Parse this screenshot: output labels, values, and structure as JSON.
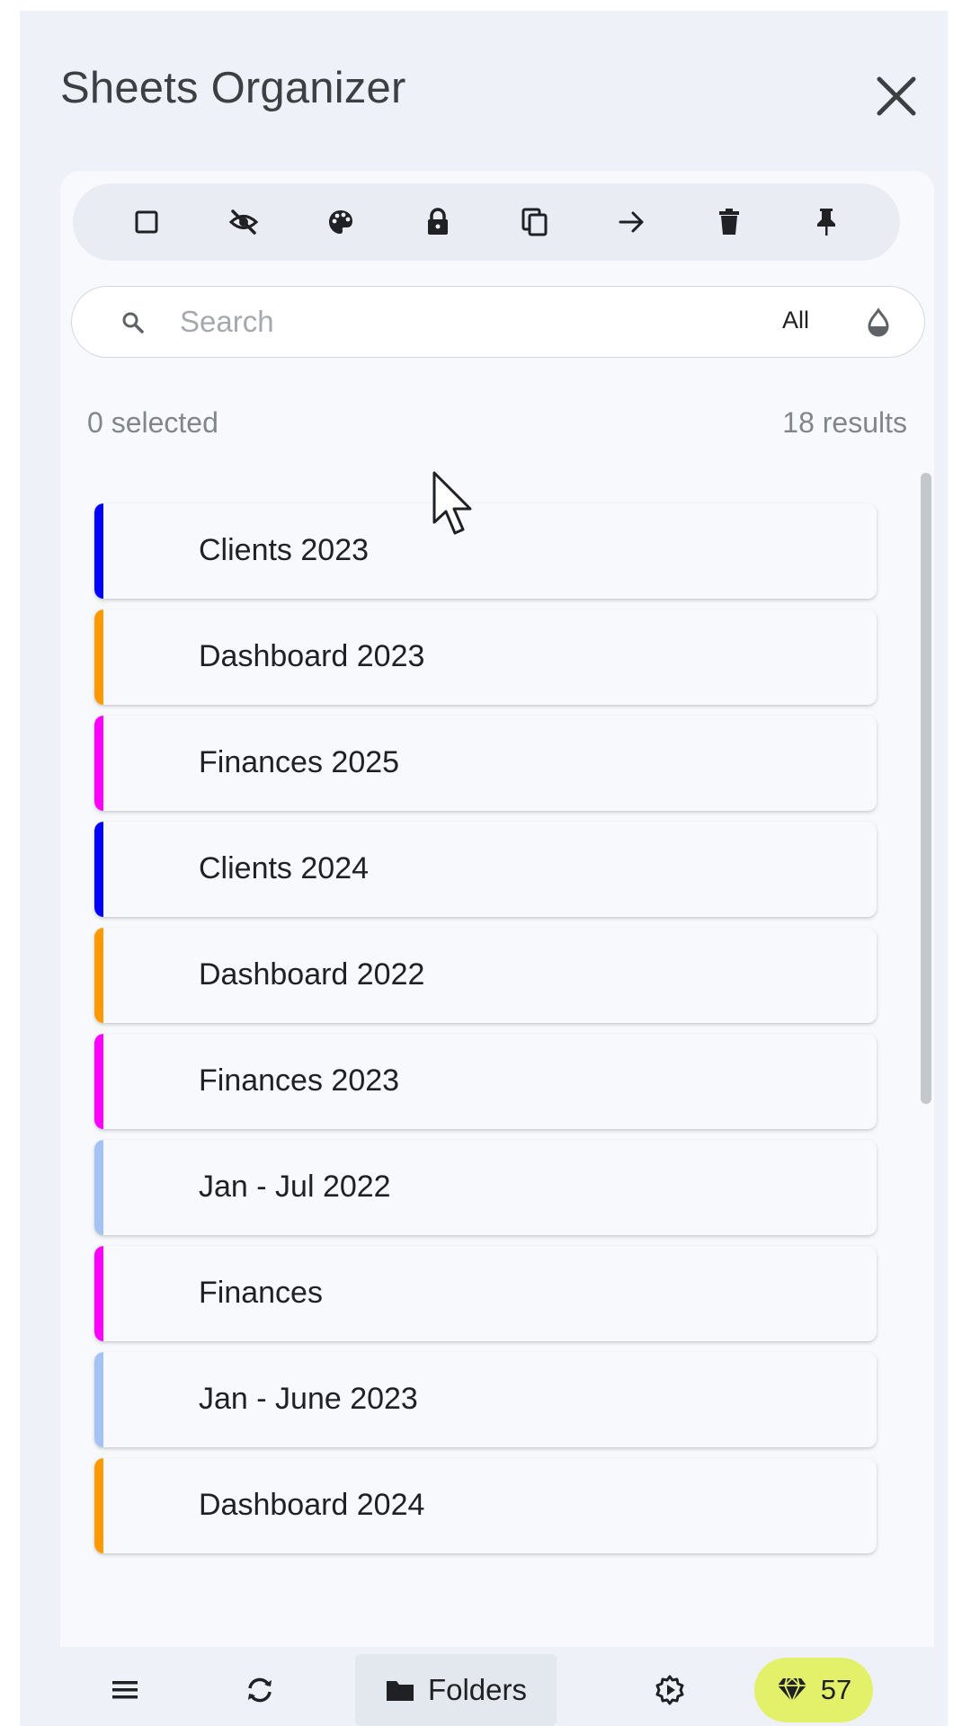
{
  "app": {
    "title": "Sheets Organizer",
    "close_icon": "close-icon"
  },
  "toolbar": {
    "tools": [
      {
        "icon": "checkbox-icon",
        "label": "Select"
      },
      {
        "icon": "eye-off-icon",
        "label": "Hide"
      },
      {
        "icon": "palette-icon",
        "label": "Color"
      },
      {
        "icon": "lock-icon",
        "label": "Protect"
      },
      {
        "icon": "copy-icon",
        "label": "Duplicate"
      },
      {
        "icon": "arrow-right-icon",
        "label": "Move"
      },
      {
        "icon": "trash-icon",
        "label": "Delete"
      },
      {
        "icon": "pin-icon",
        "label": "Pin"
      }
    ]
  },
  "search": {
    "placeholder": "Search",
    "value": "",
    "filter": "All",
    "filter_icon": "drop-icon"
  },
  "status": {
    "selected": "0 selected",
    "results": "18 results"
  },
  "sheets": [
    {
      "name": "Clients 2023",
      "color": "#0000ff"
    },
    {
      "name": "Dashboard 2023",
      "color": "#ff9900"
    },
    {
      "name": "Finances 2025",
      "color": "#ff00ff"
    },
    {
      "name": "Clients 2024",
      "color": "#0000ff"
    },
    {
      "name": "Dashboard 2022",
      "color": "#ff9900"
    },
    {
      "name": "Finances 2023",
      "color": "#ff00ff"
    },
    {
      "name": "Jan - Jul 2022",
      "color": "#a4c2f4"
    },
    {
      "name": "Finances",
      "color": "#ff00ff"
    },
    {
      "name": "Jan - June 2023",
      "color": "#a4c2f4"
    },
    {
      "name": "Dashboard 2024",
      "color": "#ff9900"
    }
  ],
  "bottom_bar": {
    "menu_icon": "menu-icon",
    "refresh_icon": "refresh-icon",
    "folders_label": "Folders",
    "folder_icon": "folder-icon",
    "settings_icon": "settings-icon",
    "credits_icon": "gem-icon",
    "credits": "57",
    "credits_color": "#e3f06a"
  }
}
